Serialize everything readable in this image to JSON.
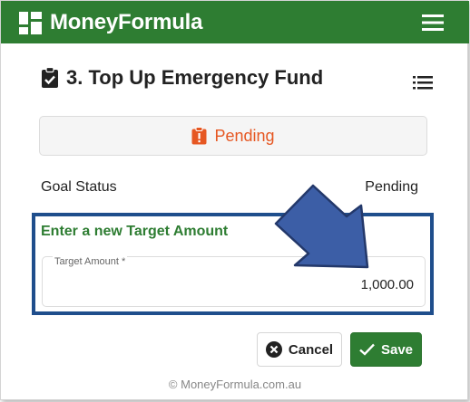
{
  "app": {
    "title": "MoneyFormula",
    "accent_color": "#2e7d32",
    "logo_icon": "dashboard-grid-icon",
    "menu_icon": "hamburger-menu-icon"
  },
  "page": {
    "title": "3. Top Up Emergency Fund",
    "title_icon": "clipboard-check-icon",
    "list_icon": "list-icon"
  },
  "status_card": {
    "icon": "clipboard-alert-icon",
    "text": "Pending",
    "color": "#e65722"
  },
  "goal_status": {
    "label": "Goal Status",
    "value": "Pending"
  },
  "target_section": {
    "heading": "Enter a new Target Amount",
    "field_label": "Target Amount *",
    "field_value": "1,000.00",
    "highlight_color": "#1f4e8c"
  },
  "buttons": {
    "cancel_label": "Cancel",
    "save_label": "Save"
  },
  "footer": {
    "text": "© MoneyFormula.com.au"
  }
}
